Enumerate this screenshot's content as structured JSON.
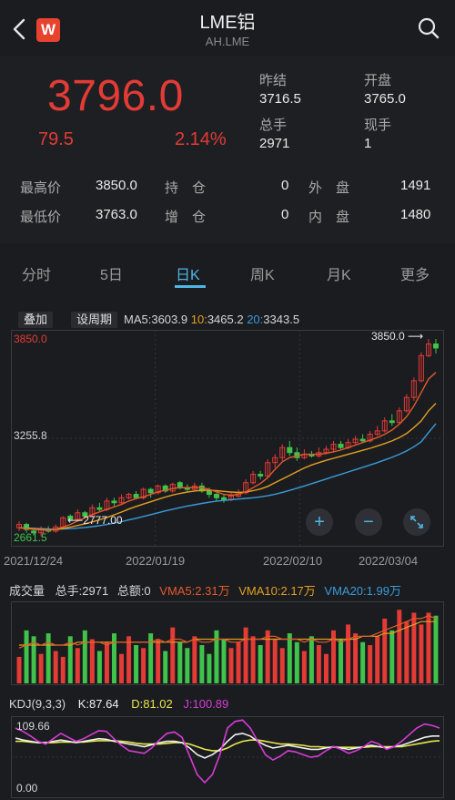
{
  "header": {
    "logo_text": "W",
    "title": "LME铝",
    "subtitle": "AH.LME"
  },
  "quote": {
    "price": "3796.0",
    "change": "79.5",
    "change_pct": "2.14%",
    "prev_close_label": "昨结",
    "prev_close": "3716.5",
    "open_label": "开盘",
    "open": "3765.0",
    "volume_label": "总手",
    "volume": "2971",
    "now_hand_label": "现手",
    "now_hand": "1",
    "high_label": "最高价",
    "high": "3850.0",
    "low_label": "最低价",
    "low": "3763.0",
    "hold_label": "持　仓",
    "hold": "0",
    "add_label": "增　仓",
    "add": "0",
    "outer_label": "外　盘",
    "outer": "1491",
    "inner_label": "内　盘",
    "inner": "1480",
    "up_color": "#e33b35"
  },
  "tabs": [
    {
      "label": "分时"
    },
    {
      "label": "5日"
    },
    {
      "label": "日K"
    },
    {
      "label": "周K"
    },
    {
      "label": "月K"
    },
    {
      "label": "更多"
    }
  ],
  "active_tab": "日K",
  "chart_controls": {
    "overlay": "叠加",
    "set_period": "设周期",
    "ma5_label": "MA5:",
    "ma5": "3603.9",
    "ma10_label": "10:",
    "ma10": "3465.2",
    "ma20_label": "20:",
    "ma20": "3343.5"
  },
  "kline_axis": {
    "top_label": "3850.0",
    "mid_label": "3255.8",
    "bottom_label": "2661.5",
    "high_marker": "3850.0",
    "low_marker": "2777.00",
    "dates": [
      "2021/12/24",
      "2022/01/19",
      "2022/02/10",
      "2022/03/04"
    ]
  },
  "volume_panel": {
    "title": "成交量",
    "total_label": "总手:2971",
    "amount_label": "总额:0",
    "vma5": "VMA5:2.31万",
    "vma10": "VMA10:2.17万",
    "vma20": "VMA20:1.99万"
  },
  "kdj_panel": {
    "title": "KDJ(9,3,3)",
    "k": "K:87.64",
    "d": "D:81.02",
    "j": "J:100.89",
    "top_label": "109.66",
    "bottom_label": "0.00"
  },
  "colors": {
    "up": "#e33b35",
    "down": "#3fc34a",
    "ma5": "#e35a2c",
    "ma10": "#e3a021",
    "ma20": "#3a9bd8",
    "accent": "#4fb6e6",
    "k_line": "#f0f0f0",
    "d_line": "#e6e64a",
    "j_line": "#d63cd6"
  },
  "chart_data": {
    "type": "candlestick",
    "y_range": [
      2661.5,
      3850.0
    ],
    "categories_labels": [
      "2021/12/24",
      "2022/01/19",
      "2022/02/10",
      "2022/03/04"
    ],
    "candles": [
      {
        "o": 2720,
        "c": 2740,
        "h": 2760,
        "l": 2700
      },
      {
        "o": 2740,
        "c": 2710,
        "h": 2750,
        "l": 2690
      },
      {
        "o": 2700,
        "c": 2690,
        "h": 2720,
        "l": 2680
      },
      {
        "o": 2690,
        "c": 2710,
        "h": 2730,
        "l": 2670
      },
      {
        "o": 2710,
        "c": 2700,
        "h": 2730,
        "l": 2690
      },
      {
        "o": 2700,
        "c": 2725,
        "h": 2740,
        "l": 2690
      },
      {
        "o": 2720,
        "c": 2780,
        "h": 2790,
        "l": 2710
      },
      {
        "o": 2790,
        "c": 2770,
        "h": 2800,
        "l": 2760
      },
      {
        "o": 2770,
        "c": 2810,
        "h": 2830,
        "l": 2760
      },
      {
        "o": 2810,
        "c": 2790,
        "h": 2820,
        "l": 2780
      },
      {
        "o": 2790,
        "c": 2840,
        "h": 2860,
        "l": 2780
      },
      {
        "o": 2840,
        "c": 2830,
        "h": 2870,
        "l": 2820
      },
      {
        "o": 2830,
        "c": 2880,
        "h": 2900,
        "l": 2820
      },
      {
        "o": 2880,
        "c": 2870,
        "h": 2900,
        "l": 2850
      },
      {
        "o": 2870,
        "c": 2900,
        "h": 2920,
        "l": 2860
      },
      {
        "o": 2900,
        "c": 2920,
        "h": 2930,
        "l": 2890
      },
      {
        "o": 2920,
        "c": 2900,
        "h": 2940,
        "l": 2890
      },
      {
        "o": 2900,
        "c": 2950,
        "h": 2960,
        "l": 2890
      },
      {
        "o": 2950,
        "c": 2930,
        "h": 2960,
        "l": 2900
      },
      {
        "o": 2930,
        "c": 2970,
        "h": 2980,
        "l": 2920
      },
      {
        "o": 2970,
        "c": 2940,
        "h": 2980,
        "l": 2930
      },
      {
        "o": 2940,
        "c": 2980,
        "h": 2990,
        "l": 2930
      },
      {
        "o": 2990,
        "c": 2960,
        "h": 3000,
        "l": 2950
      },
      {
        "o": 2960,
        "c": 2950,
        "h": 2980,
        "l": 2940
      },
      {
        "o": 2950,
        "c": 2970,
        "h": 2990,
        "l": 2940
      },
      {
        "o": 2970,
        "c": 2940,
        "h": 2990,
        "l": 2930
      },
      {
        "o": 2940,
        "c": 2920,
        "h": 2960,
        "l": 2900
      },
      {
        "o": 2920,
        "c": 2900,
        "h": 2930,
        "l": 2880
      },
      {
        "o": 2900,
        "c": 2890,
        "h": 2920,
        "l": 2870
      },
      {
        "o": 2890,
        "c": 2910,
        "h": 2930,
        "l": 2880
      },
      {
        "o": 2910,
        "c": 2930,
        "h": 2950,
        "l": 2900
      },
      {
        "o": 2930,
        "c": 2990,
        "h": 3010,
        "l": 2920
      },
      {
        "o": 2990,
        "c": 3040,
        "h": 3060,
        "l": 2980
      },
      {
        "o": 3040,
        "c": 3030,
        "h": 3060,
        "l": 3010
      },
      {
        "o": 3030,
        "c": 3110,
        "h": 3130,
        "l": 3020
      },
      {
        "o": 3110,
        "c": 3140,
        "h": 3160,
        "l": 3080
      },
      {
        "o": 3140,
        "c": 3200,
        "h": 3220,
        "l": 3120
      },
      {
        "o": 3200,
        "c": 3170,
        "h": 3240,
        "l": 3150
      },
      {
        "o": 3170,
        "c": 3140,
        "h": 3200,
        "l": 3120
      },
      {
        "o": 3140,
        "c": 3160,
        "h": 3190,
        "l": 3130
      },
      {
        "o": 3160,
        "c": 3150,
        "h": 3180,
        "l": 3140
      },
      {
        "o": 3150,
        "c": 3170,
        "h": 3200,
        "l": 3140
      },
      {
        "o": 3170,
        "c": 3190,
        "h": 3210,
        "l": 3160
      },
      {
        "o": 3190,
        "c": 3220,
        "h": 3240,
        "l": 3170
      },
      {
        "o": 3220,
        "c": 3200,
        "h": 3240,
        "l": 3190
      },
      {
        "o": 3200,
        "c": 3230,
        "h": 3250,
        "l": 3190
      },
      {
        "o": 3230,
        "c": 3250,
        "h": 3270,
        "l": 3220
      },
      {
        "o": 3250,
        "c": 3240,
        "h": 3280,
        "l": 3230
      },
      {
        "o": 3240,
        "c": 3280,
        "h": 3300,
        "l": 3230
      },
      {
        "o": 3280,
        "c": 3300,
        "h": 3330,
        "l": 3270
      },
      {
        "o": 3300,
        "c": 3360,
        "h": 3380,
        "l": 3290
      },
      {
        "o": 3360,
        "c": 3350,
        "h": 3400,
        "l": 3330
      },
      {
        "o": 3350,
        "c": 3420,
        "h": 3440,
        "l": 3340
      },
      {
        "o": 3420,
        "c": 3500,
        "h": 3520,
        "l": 3410
      },
      {
        "o": 3500,
        "c": 3600,
        "h": 3620,
        "l": 3480
      },
      {
        "o": 3600,
        "c": 3750,
        "h": 3770,
        "l": 3590
      },
      {
        "o": 3750,
        "c": 3820,
        "h": 3850,
        "l": 3740
      },
      {
        "o": 3820,
        "c": 3796,
        "h": 3850,
        "l": 3763
      }
    ],
    "ma5": [
      2720,
      2715,
      2710,
      2708,
      2705,
      2712,
      2725,
      2740,
      2760,
      2780,
      2800,
      2815,
      2830,
      2845,
      2860,
      2880,
      2895,
      2905,
      2920,
      2935,
      2945,
      2955,
      2960,
      2960,
      2962,
      2960,
      2950,
      2935,
      2920,
      2915,
      2920,
      2935,
      2960,
      2985,
      3020,
      3070,
      3115,
      3140,
      3150,
      3160,
      3160,
      3160,
      3165,
      3175,
      3185,
      3200,
      3215,
      3230,
      3245,
      3260,
      3280,
      3305,
      3340,
      3385,
      3450,
      3530,
      3610,
      3650
    ],
    "ma10": [
      2720,
      2718,
      2714,
      2711,
      2708,
      2710,
      2716,
      2724,
      2734,
      2744,
      2755,
      2768,
      2782,
      2798,
      2814,
      2832,
      2848,
      2862,
      2876,
      2890,
      2904,
      2916,
      2926,
      2934,
      2940,
      2945,
      2945,
      2942,
      2938,
      2934,
      2932,
      2934,
      2942,
      2952,
      2968,
      2990,
      3012,
      3034,
      3056,
      3078,
      3096,
      3110,
      3124,
      3136,
      3148,
      3160,
      3172,
      3184,
      3196,
      3210,
      3224,
      3240,
      3260,
      3284,
      3320,
      3360,
      3420,
      3465
    ],
    "ma20": [
      2720,
      2719,
      2717,
      2715,
      2713,
      2712,
      2713,
      2715,
      2718,
      2722,
      2727,
      2733,
      2740,
      2748,
      2757,
      2767,
      2777,
      2788,
      2799,
      2810,
      2821,
      2831,
      2841,
      2850,
      2858,
      2866,
      2873,
      2879,
      2884,
      2888,
      2892,
      2896,
      2900,
      2905,
      2912,
      2921,
      2932,
      2944,
      2957,
      2970,
      2984,
      2998,
      3012,
      3026,
      3040,
      3054,
      3068,
      3082,
      3096,
      3110,
      3126,
      3142,
      3160,
      3180,
      3205,
      3235,
      3290,
      3343
    ]
  },
  "volume_data": {
    "bars": [
      9,
      18,
      16,
      10,
      17,
      11,
      9,
      16,
      12,
      18,
      15,
      11,
      14,
      17,
      10,
      16,
      13,
      12,
      17,
      15,
      11,
      19,
      14,
      12,
      16,
      13,
      10,
      18,
      15,
      12,
      14,
      19,
      16,
      13,
      18,
      15,
      12,
      17,
      14,
      11,
      16,
      13,
      10,
      18,
      15,
      20,
      17,
      14,
      13,
      16,
      22,
      18,
      25,
      21,
      24,
      20,
      24,
      23
    ],
    "vma5": [
      12,
      13,
      14,
      13,
      14,
      13,
      13,
      14,
      13,
      14,
      14,
      14,
      13,
      14,
      14,
      14,
      14,
      14,
      14,
      15,
      14,
      15,
      15,
      14,
      15,
      14,
      14,
      15,
      15,
      14,
      14,
      15,
      15,
      15,
      16,
      16,
      15,
      15,
      15,
      14,
      15,
      14,
      14,
      15,
      14,
      15,
      16,
      16,
      16,
      17,
      18,
      19,
      20,
      21,
      22,
      22,
      23,
      22
    ],
    "vma10": [
      13,
      13,
      13,
      13,
      13,
      13,
      13,
      13,
      14,
      14,
      14,
      14,
      14,
      14,
      14,
      14,
      14,
      14,
      14,
      14,
      14,
      14,
      14,
      14,
      15,
      15,
      15,
      15,
      15,
      15,
      15,
      15,
      15,
      15,
      15,
      15,
      15,
      15,
      15,
      15,
      15,
      15,
      15,
      15,
      15,
      15,
      15,
      16,
      16,
      16,
      17,
      17,
      18,
      19,
      20,
      21,
      21,
      21
    ]
  },
  "kdj_data": {
    "range": [
      0,
      109.66
    ],
    "k": [
      85,
      82,
      80,
      78,
      78,
      80,
      82,
      80,
      78,
      80,
      82,
      84,
      83,
      80,
      78,
      76,
      74,
      72,
      75,
      78,
      80,
      80,
      78,
      70,
      60,
      55,
      60,
      68,
      80,
      90,
      92,
      88,
      80,
      74,
      70,
      72,
      74,
      72,
      70,
      68,
      68,
      70,
      72,
      70,
      68,
      70,
      72,
      74,
      72,
      70,
      72,
      74,
      78,
      82,
      86,
      88,
      88
    ],
    "d": [
      80,
      80,
      79,
      78,
      78,
      78,
      79,
      79,
      79,
      79,
      80,
      81,
      81,
      81,
      80,
      79,
      77,
      76,
      76,
      76,
      77,
      78,
      78,
      76,
      72,
      68,
      66,
      66,
      70,
      76,
      80,
      82,
      82,
      80,
      78,
      76,
      76,
      75,
      74,
      72,
      72,
      71,
      71,
      71,
      71,
      71,
      71,
      72,
      72,
      72,
      72,
      72,
      74,
      76,
      78,
      80,
      81
    ],
    "j": [
      100,
      95,
      88,
      80,
      76,
      84,
      92,
      86,
      80,
      84,
      90,
      96,
      95,
      84,
      74,
      66,
      64,
      62,
      70,
      82,
      92,
      94,
      86,
      58,
      30,
      18,
      30,
      60,
      100,
      110,
      112,
      100,
      80,
      60,
      52,
      58,
      66,
      64,
      60,
      56,
      58,
      66,
      72,
      68,
      62,
      66,
      72,
      80,
      76,
      68,
      72,
      80,
      90,
      100,
      106,
      104,
      100
    ]
  }
}
